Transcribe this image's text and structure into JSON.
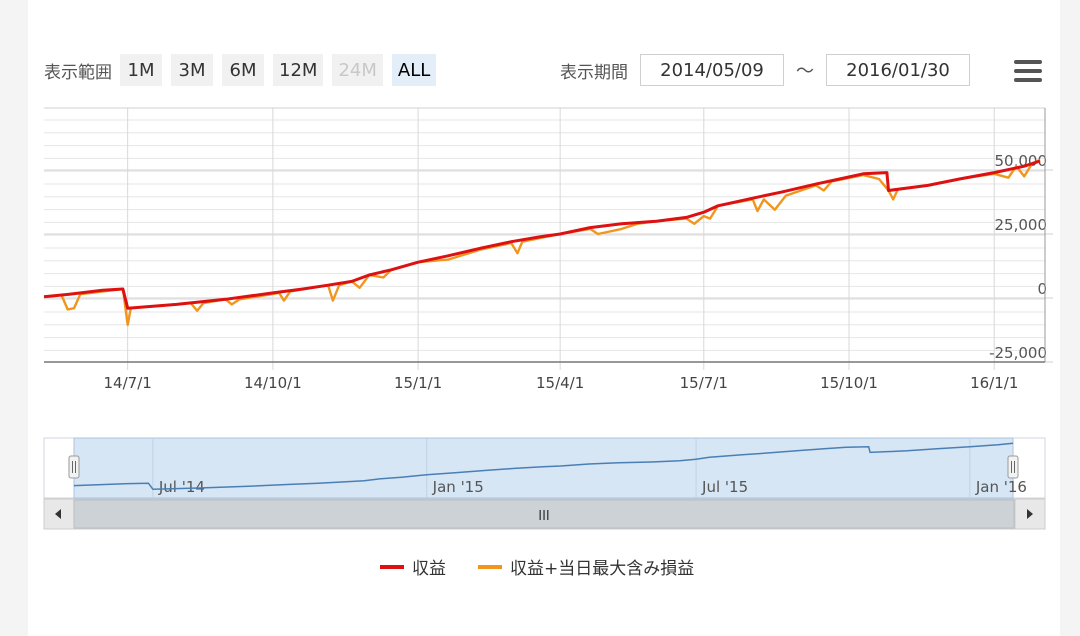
{
  "range_selector": {
    "label": "表示範囲",
    "buttons": [
      {
        "label": "1M",
        "state": "normal"
      },
      {
        "label": "3M",
        "state": "normal"
      },
      {
        "label": "6M",
        "state": "normal"
      },
      {
        "label": "12M",
        "state": "normal"
      },
      {
        "label": "24M",
        "state": "disabled"
      },
      {
        "label": "ALL",
        "state": "active"
      }
    ]
  },
  "period": {
    "label": "表示期間",
    "from": "2014/05/09",
    "separator": "～",
    "to": "2016/01/30"
  },
  "menu_icon": "hamburger-menu-icon",
  "colors": {
    "profit": "#dd1111",
    "profit_with_dd": "#f0961e",
    "navigator_fill": "#d6e6f5",
    "navigator_line": "#4a7fb5"
  },
  "chart_data": {
    "type": "line",
    "title": "",
    "xlabel": "",
    "ylabel": "",
    "x_range": [
      "2014-05-09",
      "2016-01-30"
    ],
    "ylim": [
      -25000,
      65000
    ],
    "y_ticks": [
      50000,
      25000,
      0,
      -25000
    ],
    "y_tick_labels": [
      "50,000",
      "25,000",
      "0",
      "-25,000"
    ],
    "x_ticks": [
      "2014-07-01",
      "2014-10-01",
      "2015-01-01",
      "2015-04-01",
      "2015-07-01",
      "2015-10-01",
      "2016-01-01"
    ],
    "x_tick_labels": [
      "14/7/1",
      "14/10/1",
      "15/1/1",
      "15/4/1",
      "15/7/1",
      "15/10/1",
      "16/1/1"
    ],
    "grid": true,
    "legend_position": "bottom",
    "series": [
      {
        "name": "収益",
        "points": [
          [
            "2014-05-09",
            500
          ],
          [
            "2014-05-25",
            1500
          ],
          [
            "2014-06-15",
            3000
          ],
          [
            "2014-06-28",
            3500
          ],
          [
            "2014-07-01",
            -4000
          ],
          [
            "2014-08-01",
            -2500
          ],
          [
            "2014-09-01",
            -500
          ],
          [
            "2014-10-01",
            2000
          ],
          [
            "2014-10-20",
            3500
          ],
          [
            "2014-11-05",
            5000
          ],
          [
            "2014-11-20",
            6500
          ],
          [
            "2014-12-01",
            9000
          ],
          [
            "2014-12-15",
            11000
          ],
          [
            "2015-01-01",
            14000
          ],
          [
            "2015-01-20",
            16500
          ],
          [
            "2015-02-10",
            19500
          ],
          [
            "2015-03-01",
            22000
          ],
          [
            "2015-03-20",
            24000
          ],
          [
            "2015-04-01",
            25000
          ],
          [
            "2015-04-20",
            27500
          ],
          [
            "2015-05-10",
            29000
          ],
          [
            "2015-06-01",
            30000
          ],
          [
            "2015-06-20",
            31500
          ],
          [
            "2015-07-01",
            33500
          ],
          [
            "2015-07-10",
            36000
          ],
          [
            "2015-08-01",
            39000
          ],
          [
            "2015-08-20",
            41500
          ],
          [
            "2015-09-10",
            44500
          ],
          [
            "2015-09-25",
            46500
          ],
          [
            "2015-10-10",
            48500
          ],
          [
            "2015-10-25",
            49000
          ],
          [
            "2015-10-26",
            42000
          ],
          [
            "2015-11-20",
            44000
          ],
          [
            "2015-12-10",
            46500
          ],
          [
            "2016-01-01",
            49000
          ],
          [
            "2016-01-20",
            51500
          ],
          [
            "2016-01-30",
            53500
          ]
        ]
      },
      {
        "name": "収益+当日最大含み損益",
        "points": [
          [
            "2014-05-09",
            500
          ],
          [
            "2014-05-20",
            1200
          ],
          [
            "2014-05-24",
            -4500
          ],
          [
            "2014-05-28",
            -4000
          ],
          [
            "2014-06-01",
            1500
          ],
          [
            "2014-06-28",
            3500
          ],
          [
            "2014-07-01",
            -10500
          ],
          [
            "2014-07-03",
            -4000
          ],
          [
            "2014-08-10",
            -2000
          ],
          [
            "2014-08-14",
            -5000
          ],
          [
            "2014-08-18",
            -2000
          ],
          [
            "2014-09-01",
            -500
          ],
          [
            "2014-09-05",
            -2500
          ],
          [
            "2014-09-10",
            -500
          ],
          [
            "2014-10-05",
            2000
          ],
          [
            "2014-10-08",
            -1000
          ],
          [
            "2014-10-12",
            2500
          ],
          [
            "2014-10-25",
            4000
          ],
          [
            "2014-11-05",
            5000
          ],
          [
            "2014-11-08",
            -1000
          ],
          [
            "2014-11-12",
            5000
          ],
          [
            "2014-11-20",
            6500
          ],
          [
            "2014-11-25",
            4000
          ],
          [
            "2014-12-01",
            9000
          ],
          [
            "2014-12-10",
            8000
          ],
          [
            "2014-12-15",
            11000
          ],
          [
            "2015-01-01",
            14000
          ],
          [
            "2015-01-20",
            15000
          ],
          [
            "2015-02-10",
            19000
          ],
          [
            "2015-03-01",
            21500
          ],
          [
            "2015-03-05",
            17500
          ],
          [
            "2015-03-08",
            22000
          ],
          [
            "2015-04-01",
            25000
          ],
          [
            "2015-04-20",
            27000
          ],
          [
            "2015-04-25",
            25000
          ],
          [
            "2015-05-10",
            27000
          ],
          [
            "2015-05-20",
            29000
          ],
          [
            "2015-06-01",
            30000
          ],
          [
            "2015-06-20",
            31000
          ],
          [
            "2015-06-25",
            29000
          ],
          [
            "2015-07-01",
            32000
          ],
          [
            "2015-07-05",
            31000
          ],
          [
            "2015-07-10",
            36000
          ],
          [
            "2015-08-01",
            38500
          ],
          [
            "2015-08-04",
            34000
          ],
          [
            "2015-08-08",
            38500
          ],
          [
            "2015-08-15",
            34500
          ],
          [
            "2015-08-22",
            40000
          ],
          [
            "2015-09-10",
            44000
          ],
          [
            "2015-09-15",
            42000
          ],
          [
            "2015-09-20",
            45500
          ],
          [
            "2015-10-10",
            48000
          ],
          [
            "2015-10-20",
            46500
          ],
          [
            "2015-10-26",
            42000
          ],
          [
            "2015-10-29",
            38500
          ],
          [
            "2015-11-01",
            42500
          ],
          [
            "2015-11-20",
            44000
          ],
          [
            "2015-12-10",
            46500
          ],
          [
            "2016-01-01",
            48500
          ],
          [
            "2016-01-10",
            47000
          ],
          [
            "2016-01-15",
            51500
          ],
          [
            "2016-01-20",
            47500
          ],
          [
            "2016-01-25",
            52500
          ],
          [
            "2016-01-30",
            54000
          ]
        ]
      }
    ]
  },
  "navigator": {
    "x_tick_labels": [
      "Jul '14",
      "Jan '15",
      "Jul '15",
      "Jan '16"
    ],
    "x_ticks": [
      "2014-07-01",
      "2015-01-01",
      "2015-07-01",
      "2016-01-01"
    ],
    "scrollbar_grip": "III"
  }
}
